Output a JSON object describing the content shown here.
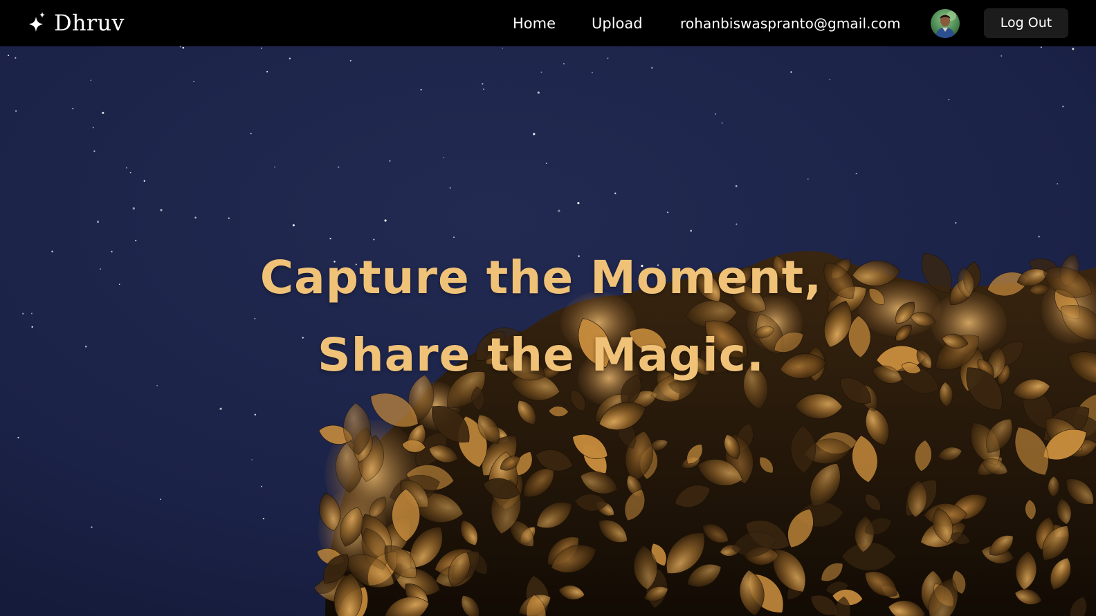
{
  "brand": {
    "name": "Dhruv",
    "icon": "sparkle-icon"
  },
  "nav": {
    "home_label": "Home",
    "upload_label": "Upload",
    "user_email": "rohanbiswaspranto@gmail.com",
    "avatar_icon": "user-avatar",
    "logout_label": "Log Out"
  },
  "hero": {
    "headline_line1": "Capture the Moment,",
    "headline_line2": "Share the Magic.",
    "background": "night-sky-with-tree",
    "accent_color": "#f0c278"
  },
  "colors": {
    "navbar_bg": "#000000",
    "sky": "#1c2346",
    "foliage_highlight": "#c9944a",
    "foliage_shadow": "#2a1a08"
  }
}
